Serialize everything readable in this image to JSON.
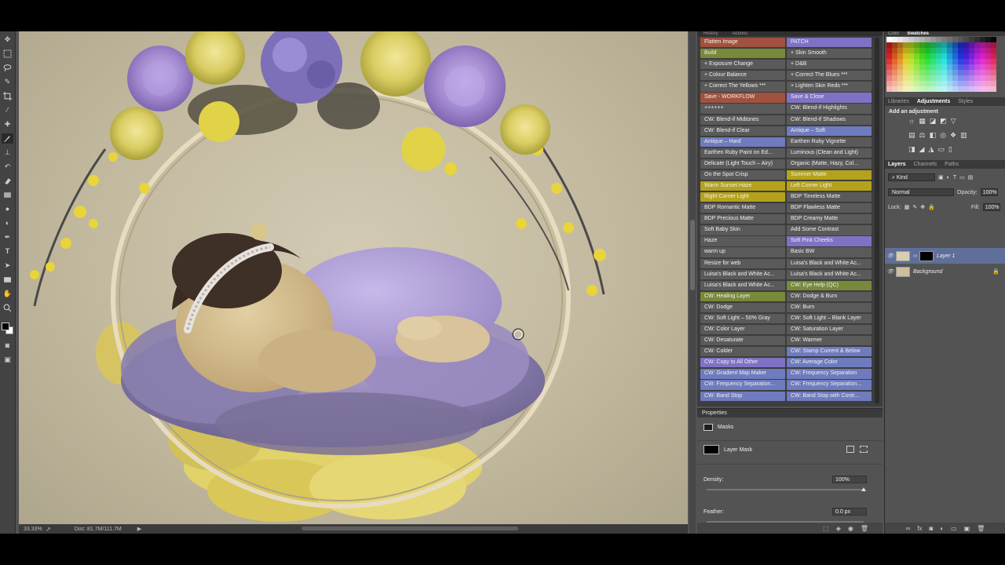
{
  "status": {
    "zoom": "33.33%",
    "doc": "Doc: 81.7M/111.7M"
  },
  "actions_panel": {
    "tab_left": "History",
    "tab_right": "Actions",
    "items": [
      {
        "label": "Flatten Image",
        "color": "red"
      },
      {
        "label": "PATCH",
        "color": "purple"
      },
      {
        "label": "Build",
        "color": "green"
      },
      {
        "label": "+ Skin Smooth",
        "color": "gray"
      },
      {
        "label": "+ Exposure Change",
        "color": "gray"
      },
      {
        "label": "+ D&B",
        "color": "gray"
      },
      {
        "label": "+ Colour Balance",
        "color": "gray"
      },
      {
        "label": "+ Correct The Blues ***",
        "color": "gray"
      },
      {
        "label": "+ Correct The Yellows ***",
        "color": "gray"
      },
      {
        "label": "+ Lighten Skin Reds ***",
        "color": "gray"
      },
      {
        "label": "Save - WORKFLOW",
        "color": "red"
      },
      {
        "label": "Save & Close",
        "color": "purple"
      },
      {
        "label": "++++++",
        "color": "gray"
      },
      {
        "label": "CW: Blend-if Highlights",
        "color": "gray"
      },
      {
        "label": "CW: Blend-if Midtones",
        "color": "gray"
      },
      {
        "label": "CW: Blend-if Shadows",
        "color": "gray"
      },
      {
        "label": "CW: Blend-if Clear",
        "color": "gray"
      },
      {
        "label": "Antique – Soft",
        "color": "blue"
      },
      {
        "label": "Antique – Hard",
        "color": "blue"
      },
      {
        "label": "Earthen Ruby Vignette",
        "color": "gray"
      },
      {
        "label": "Earthen Ruby Paint on Ed...",
        "color": "gray"
      },
      {
        "label": "Luminous (Clean and Light)",
        "color": "gray"
      },
      {
        "label": "Delicate (Light Touch – Airy)",
        "color": "gray"
      },
      {
        "label": "Organic (Matte, Hazy, Col...",
        "color": "gray"
      },
      {
        "label": "On the Spot Crisp",
        "color": "gray"
      },
      {
        "label": "Summer Matte",
        "color": "yellow"
      },
      {
        "label": "Warm Sunset Haze",
        "color": "yellow"
      },
      {
        "label": "Left Corner Light",
        "color": "yellow"
      },
      {
        "label": "Right Corner Light",
        "color": "yellow"
      },
      {
        "label": "BDP Timeless Matte",
        "color": "gray"
      },
      {
        "label": "BDP Romantic Matte",
        "color": "gray"
      },
      {
        "label": "BDP Flawless Matte",
        "color": "gray"
      },
      {
        "label": "BDP Precious Matte",
        "color": "gray"
      },
      {
        "label": "BDP Creamy Matte",
        "color": "gray"
      },
      {
        "label": "Soft Baby Skin",
        "color": "gray"
      },
      {
        "label": "Add Some Contrast",
        "color": "gray"
      },
      {
        "label": "Haze",
        "color": "gray"
      },
      {
        "label": "Soft Pink Cheeks",
        "color": "purple"
      },
      {
        "label": "warm up",
        "color": "gray"
      },
      {
        "label": "Basic BW",
        "color": "gray"
      },
      {
        "label": "Resize for web",
        "color": "gray"
      },
      {
        "label": "Luisa's Black and White Ac...",
        "color": "gray"
      },
      {
        "label": "Luisa's Black and White Ac...",
        "color": "gray"
      },
      {
        "label": "Luisa's Black and White Ac...",
        "color": "gray"
      },
      {
        "label": "Luisa's Black and White Ac...",
        "color": "gray"
      },
      {
        "label": "CW: Eye Help (QC)",
        "color": "green"
      },
      {
        "label": "CW: Healing Layer",
        "color": "green"
      },
      {
        "label": "CW: Dodge & Burn",
        "color": "gray"
      },
      {
        "label": "CW: Dodge",
        "color": "gray"
      },
      {
        "label": "CW: Burn",
        "color": "gray"
      },
      {
        "label": "CW: Soft Light – 50% Gray",
        "color": "gray"
      },
      {
        "label": "CW: Soft Light – Blank Layer",
        "color": "gray"
      },
      {
        "label": "CW: Color Layer",
        "color": "gray"
      },
      {
        "label": "CW: Saturation Layer",
        "color": "gray"
      },
      {
        "label": "CW: Desaturate",
        "color": "gray"
      },
      {
        "label": "CW: Warmer",
        "color": "gray"
      },
      {
        "label": "CW: Colder",
        "color": "gray"
      },
      {
        "label": "CW: Stamp Current & Below",
        "color": "blue"
      },
      {
        "label": "CW: Copy to All Other",
        "color": "purple"
      },
      {
        "label": "CW: Average Color",
        "color": "blue"
      },
      {
        "label": "CW: Gradient Map Maker",
        "color": "blue"
      },
      {
        "label": "CW: Frequency Separation",
        "color": "blue"
      },
      {
        "label": "CW: Frequency Separation...",
        "color": "blue"
      },
      {
        "label": "CW: Frequency Separation...",
        "color": "blue"
      },
      {
        "label": "CW: Band Stop",
        "color": "blue"
      },
      {
        "label": "CW: Band Stop with Contr...",
        "color": "blue"
      }
    ]
  },
  "properties": {
    "title": "Properties",
    "section": "Masks",
    "mask_label": "Layer Mask",
    "density_label": "Density:",
    "density_value": "100%",
    "density_fraction": 1.0,
    "feather_label": "Feather:",
    "feather_value": "0.0 px"
  },
  "swatches_tabs": {
    "a": "Color",
    "b": "Swatches"
  },
  "adjust_tabs": {
    "libraries": "Libraries",
    "adjustments": "Adjustments",
    "styles": "Styles"
  },
  "adjust_title": "Add an adjustment",
  "layers_tabs": {
    "layers": "Layers",
    "channels": "Channels",
    "paths": "Paths"
  },
  "layers": {
    "kind": "Kind",
    "blend": "Normal",
    "opacity_label": "Opacity:",
    "opacity_value": "100%",
    "lock_label": "Lock:",
    "fill_label": "Fill:",
    "fill_value": "100%",
    "items": [
      {
        "name": "Layer 1",
        "active": true
      },
      {
        "name": "Background",
        "active": false
      }
    ]
  },
  "colors": {
    "panel": "#535353",
    "dark_panel": "#3d3d3d",
    "selection": "#5f6f9a"
  }
}
